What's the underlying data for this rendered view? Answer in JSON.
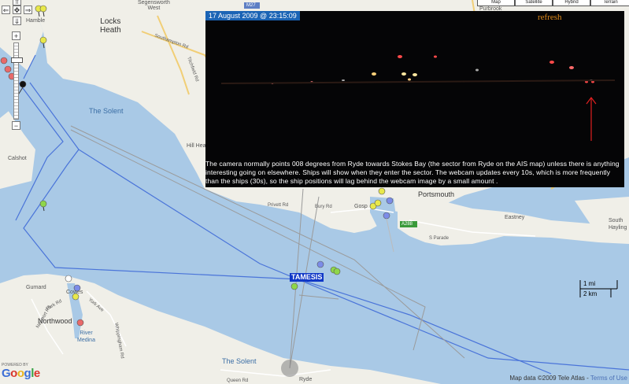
{
  "map": {
    "places": {
      "locks_heath": "Locks\nHeath",
      "hamble": "Hamble",
      "the_solent_top": "The Solent",
      "the_solent_bottom": "The Solent",
      "hill_head": "Hill Head",
      "calshot": "Calshot",
      "portsmouth": "Portsmouth",
      "gosport": "Gosp",
      "eastney": "Eastney",
      "south_hayling": "South\nHayling",
      "gurnard": "Gurnard",
      "cowes": "Cowes",
      "northwood": "Northwood",
      "river_medina": "River\nMedina",
      "ryde": "Ryde",
      "segensworth_west": "Segensworth\nWest",
      "purbrook": "Purbrook"
    },
    "roads": {
      "southampton_rd": "Southampton Rd",
      "titchfield_rd": "Titchfield Rd",
      "privett_rd": "Privett Rd",
      "bury_rd": "Bury Rd",
      "s_parade": "S Parade",
      "park_rd": "Park Rd",
      "newport_rd": "Newport Rd",
      "york_ave": "York Ave",
      "whippingham_rd": "Whippingham Rd",
      "queen_rd": "Queen Rd",
      "m27": "M27",
      "a288": "A288"
    },
    "controls": {
      "pan_up": "⇑",
      "pan_left": "⇐",
      "pan_right": "⇒",
      "pan_down": "⇓",
      "center": "✥",
      "zoom_in": "+",
      "zoom_out": "−"
    },
    "map_types": [
      "Map",
      "Satellite",
      "Hybrid",
      "Terrain"
    ],
    "scale": {
      "miles": "1 mi",
      "km": "2 km"
    },
    "copyright": "Map data ©2009 Tele Atlas",
    "terms": "Terms of Use",
    "powered_by": "POWERED BY",
    "google_logo": "Google"
  },
  "webcam": {
    "timestamp": "17 August 2009 @ 23:15:09",
    "refresh_label": "refresh",
    "caption": "The camera normally points 008 degrees from Ryde towards Stokes Bay (the sector from Ryde on the AIS map) unless there is anything interesting going on elsewhere. Ships will show when they enter the sector. The webcam updates every 10s, which is more frequently than the ships (30s), so the ship positions will lag behind the webcam image by a small amount ."
  },
  "ship_label": "TAMESIS",
  "colors": {
    "sea": "#a9c9e6",
    "land": "#f0efe8",
    "track": "#4a74d9",
    "ship_yellow": "#e8e84a",
    "ship_green": "#8fd64a",
    "ship_blue": "#7c8ce8",
    "ship_red": "#e86a6a",
    "ship_white": "#ffffff",
    "ship_black": "#111111"
  }
}
